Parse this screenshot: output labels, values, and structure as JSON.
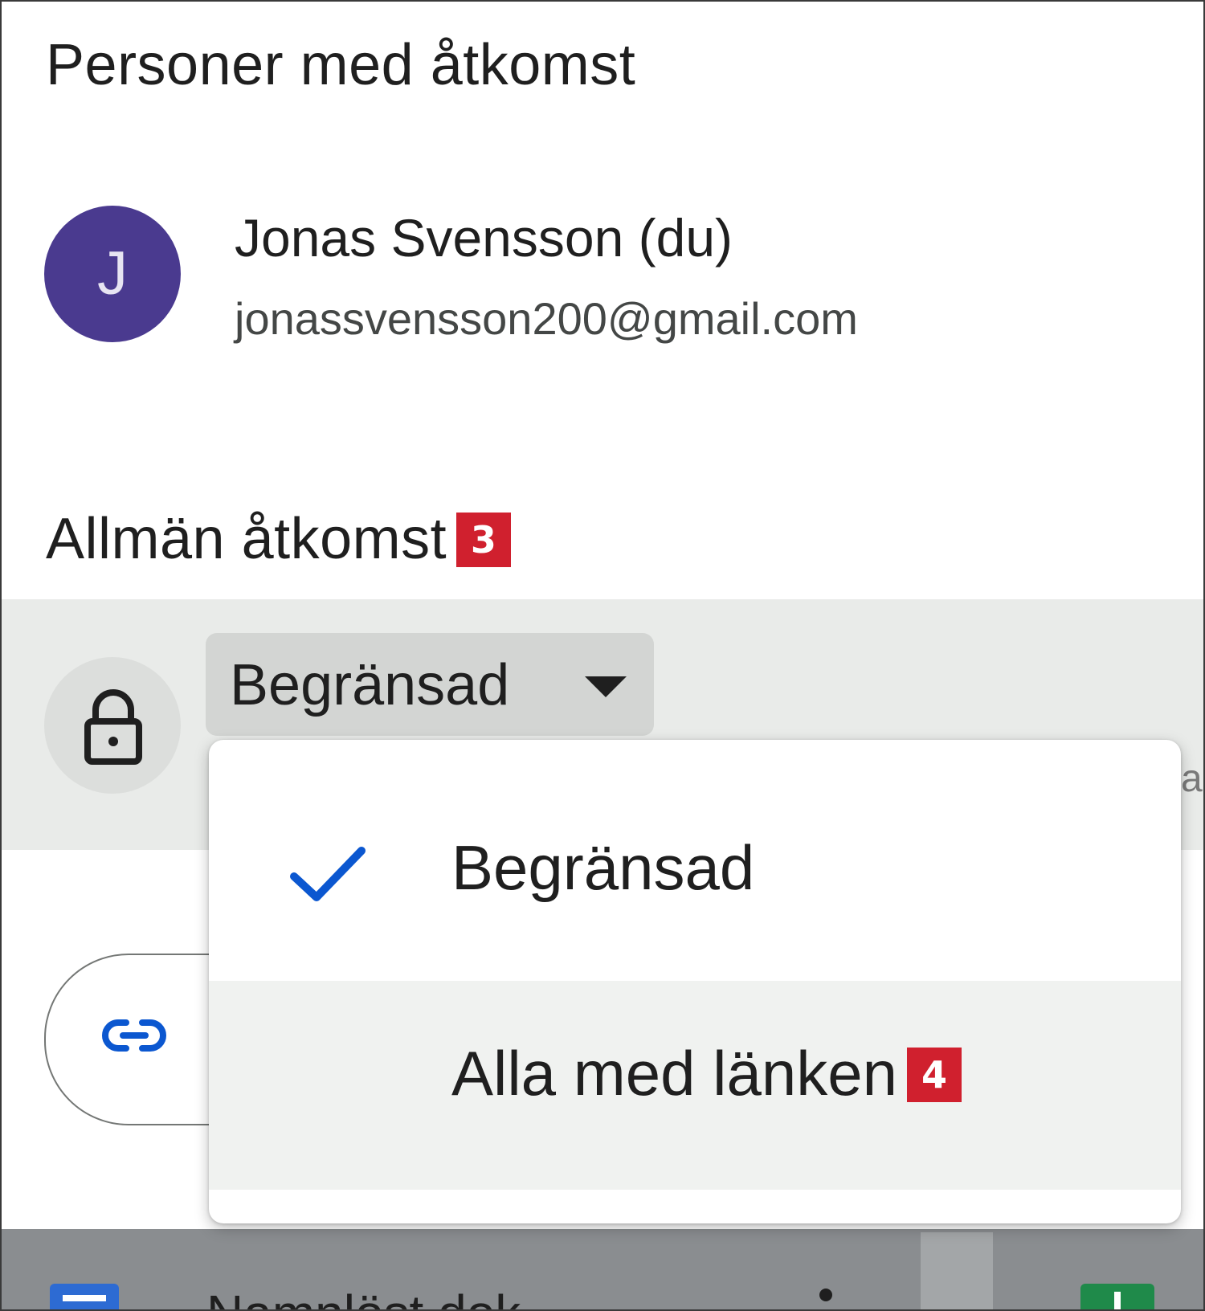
{
  "people_section": {
    "title": "Personer med åtkomst",
    "user": {
      "avatar_letter": "J",
      "name": "Jonas Svensson (du)",
      "email": "jonassvensson200@gmail.com"
    }
  },
  "general_access": {
    "title": "Allmän åtkomst",
    "title_marker": "3",
    "lock_icon": "lock-icon",
    "selected_value": "Begränsad",
    "side_text": "a"
  },
  "dropdown": {
    "options": [
      {
        "label": "Begränsad",
        "selected": true,
        "icon": "check-icon"
      },
      {
        "label": "Alla med länken",
        "selected": false,
        "marker": "4"
      }
    ]
  },
  "copy_link": {
    "icon": "link-icon"
  },
  "bottom_bar": {
    "doc_name": "Namnlöst dok"
  },
  "colors": {
    "avatar": "#4a3a8f",
    "marker": "#d0202e",
    "accent": "#0b57d0",
    "row_highlight": "#e9ebe9"
  }
}
